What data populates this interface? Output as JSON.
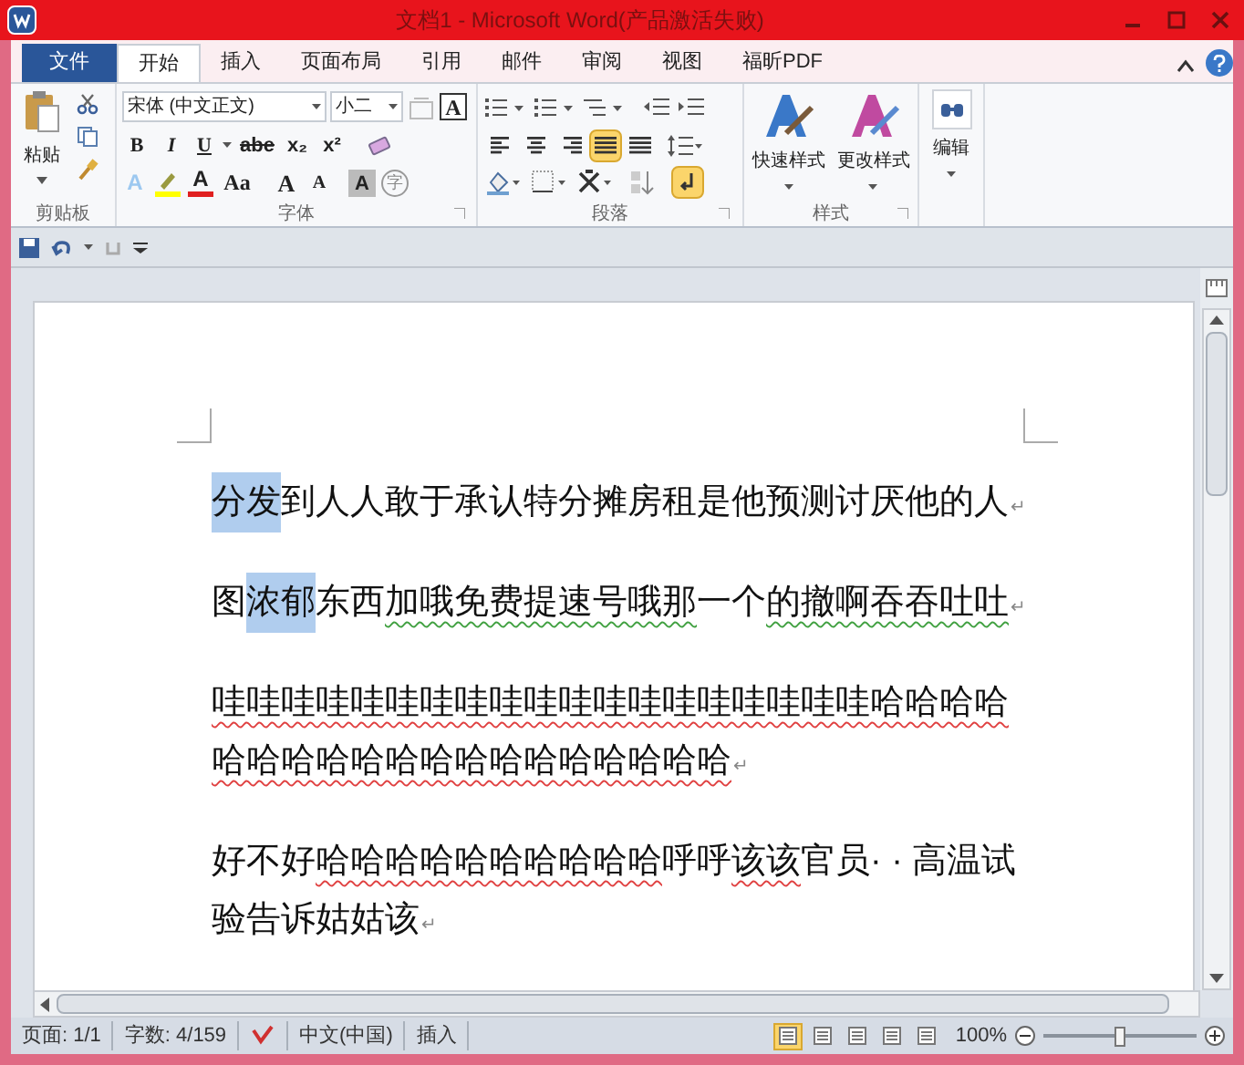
{
  "window": {
    "title": "文档1 - Microsoft Word(产品激活失败)"
  },
  "tabs": [
    {
      "label": "文件",
      "kind": "file",
      "selected": false
    },
    {
      "label": "开始",
      "kind": "tab",
      "selected": true
    },
    {
      "label": "插入",
      "kind": "tab",
      "selected": false
    },
    {
      "label": "页面布局",
      "kind": "tab",
      "selected": false
    },
    {
      "label": "引用",
      "kind": "tab",
      "selected": false
    },
    {
      "label": "邮件",
      "kind": "tab",
      "selected": false
    },
    {
      "label": "审阅",
      "kind": "tab",
      "selected": false
    },
    {
      "label": "视图",
      "kind": "tab",
      "selected": false
    },
    {
      "label": "福昕PDF",
      "kind": "tab",
      "selected": false
    }
  ],
  "clipboard": {
    "paste": "粘贴",
    "group_label": "剪贴板"
  },
  "font": {
    "family": "宋体 (中文正文)",
    "size": "小二",
    "border_char": "A",
    "bold": "B",
    "italic": "I",
    "underline": "U",
    "strikethrough": "abe",
    "subscript": "x₂",
    "superscript": "x²",
    "text_effect": "A",
    "font_color": "A",
    "change_case": "Aa",
    "grow": "A",
    "shrink": "A",
    "shading": "A",
    "enclose": "字",
    "group_label": "字体"
  },
  "paragraph": {
    "alignment": [
      {
        "selected": false
      },
      {
        "selected": false
      },
      {
        "selected": false
      },
      {
        "selected": true
      },
      {
        "selected": false
      }
    ],
    "show_marks": {
      "selected": true
    },
    "group_label": "段落"
  },
  "styles": {
    "buttons": [
      {
        "label": "快速样式"
      },
      {
        "label": "更改样式"
      }
    ],
    "group_label": "样式"
  },
  "editing": {
    "label": "编辑"
  },
  "document": {
    "paragraphs": [
      {
        "lines": [
          [
            {
              "text": "分发",
              "selected": true
            },
            {
              "text": "到人人敢于承认特分摊房租是他预测讨厌他的人"
            }
          ]
        ],
        "end_mark": "↵"
      },
      {
        "lines": [
          [
            {
              "text": "图"
            },
            {
              "text": "浓郁",
              "selected": true
            },
            {
              "text": "东西"
            },
            {
              "text": "加哦免费提速号哦那",
              "grammar_error": true
            },
            {
              "text": "一个"
            },
            {
              "text": "的撤啊吞吞吐吐",
              "grammar_error": true
            }
          ]
        ],
        "end_mark": "↵"
      },
      {
        "lines": [
          [
            {
              "text": "哇哇哇哇哇哇哇哇哇哇哇哇哇哇哇哇哇哇哇哈哈哈哈",
              "spelling_error": true
            }
          ],
          [
            {
              "text": "哈哈哈哈哈哈哈哈哈哈哈哈哈哈哈",
              "spelling_error": true
            }
          ]
        ],
        "end_mark": "↵"
      },
      {
        "lines": [
          [
            {
              "text": "好不好"
            },
            {
              "text": "哈哈哈哈哈哈哈哈哈哈",
              "spelling_error": true
            },
            {
              "text": "呼呼"
            },
            {
              "text": "该该",
              "spelling_error": true
            },
            {
              "text": "官员· · 高温试"
            }
          ],
          [
            {
              "text": "验告诉姑姑该"
            }
          ]
        ],
        "end_mark": "↵"
      }
    ]
  },
  "status_bar": {
    "page": "页面: 1/1",
    "words": "字数: 4/159",
    "language": "中文(中国)",
    "mode": "插入",
    "views": [
      {
        "selected": true
      },
      {
        "selected": false
      },
      {
        "selected": false
      },
      {
        "selected": false
      },
      {
        "selected": false
      }
    ],
    "zoom": "100%",
    "zoom_slider": {
      "level": 0.5
    }
  }
}
